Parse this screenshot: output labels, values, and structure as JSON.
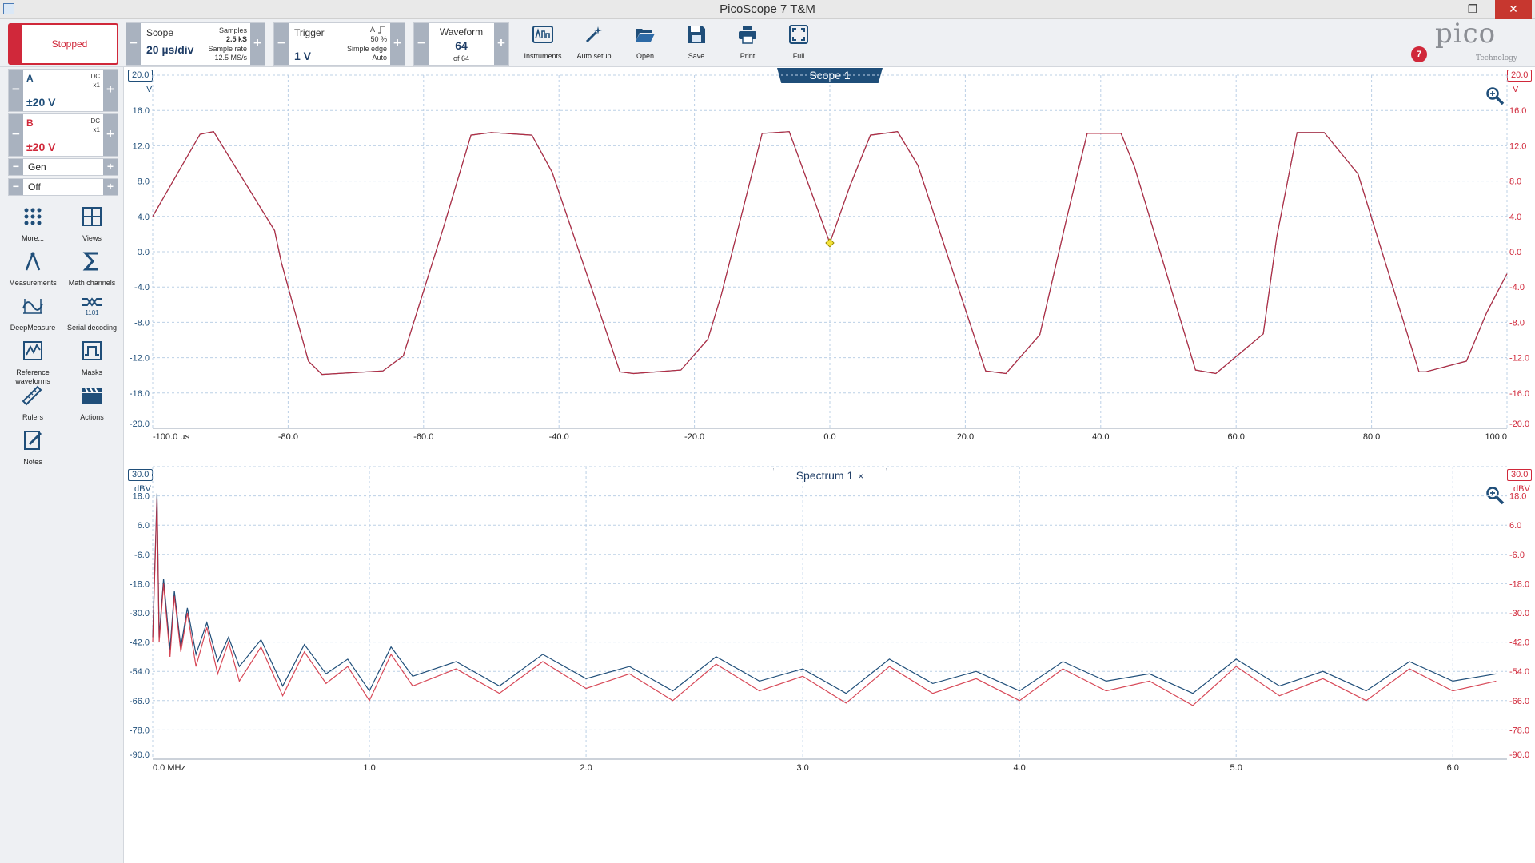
{
  "window": {
    "title": "PicoScope 7 T&M",
    "minimize": "–",
    "maximize": "❐",
    "close": "✕"
  },
  "toolbar": {
    "run_state": "Stopped",
    "scope": {
      "label": "Scope",
      "timebase": "20 µs/div",
      "samples_label": "Samples",
      "samples_value": "2.5 kS",
      "sample_rate_label": "Sample rate",
      "sample_rate_value": "12.5 MS/s"
    },
    "trigger": {
      "label": "Trigger",
      "level": "1 V",
      "channel": "A",
      "position": "50 %",
      "type": "Simple edge",
      "mode": "Auto"
    },
    "waveform": {
      "label": "Waveform",
      "current": "64",
      "of": "of 64"
    },
    "tools": [
      "Instruments",
      "Auto setup",
      "Open",
      "Save",
      "Print",
      "Full"
    ],
    "notifications": "7",
    "logo": "pico",
    "logo_sub": "Technology"
  },
  "sidebar": {
    "channels": [
      {
        "name": "A",
        "coupling": "DC",
        "probe": "x1",
        "range": "±20 V",
        "color": "#1f4e79"
      },
      {
        "name": "B",
        "coupling": "DC",
        "probe": "x1",
        "range": "±20 V",
        "color": "#d0283a"
      }
    ],
    "generator": {
      "label": "Gen",
      "state": "Off"
    },
    "tools": [
      "More...",
      "Views",
      "Measurements",
      "Math channels",
      "DeepMeasure",
      "Serial decoding",
      "Reference waveforms",
      "Masks",
      "Rulers",
      "Actions",
      "Notes"
    ]
  },
  "scope_view": {
    "tab": "Scope 1",
    "left_top": "20.0",
    "right_top": "20.0",
    "unit": "V",
    "y_ticks": [
      "16.0",
      "12.0",
      "8.0",
      "4.0",
      "0.0",
      "-4.0",
      "-8.0",
      "-12.0",
      "-16.0"
    ],
    "bottom": "-20.0",
    "x_ticks": [
      "-100.0 µs",
      "-80.0",
      "-60.0",
      "-40.0",
      "-20.0",
      "0.0",
      "20.0",
      "40.0",
      "60.0",
      "80.0",
      "100.0"
    ]
  },
  "spectrum_view": {
    "tab": "Spectrum 1",
    "close": "×",
    "left_top": "30.0",
    "right_top": "30.0",
    "unit": "dBV",
    "y_ticks": [
      "18.0",
      "6.0",
      "-6.0",
      "-18.0",
      "-30.0",
      "-42.0",
      "-54.0",
      "-66.0",
      "-78.0"
    ],
    "bottom": "-90.0",
    "x_ticks": [
      "0.0 MHz",
      "1.0",
      "2.0",
      "3.0",
      "4.0",
      "5.0",
      "6.0"
    ]
  },
  "chart_data": [
    {
      "type": "line",
      "title": "Scope 1",
      "xlabel": "µs",
      "ylabel": "V",
      "xlim": [
        -100,
        100
      ],
      "ylim": [
        -20,
        20
      ],
      "series": [
        {
          "name": "A",
          "color": "#1f4e79",
          "x": [
            -100,
            -93,
            -91,
            -82,
            -81,
            -77,
            -75,
            -66,
            -63,
            -57,
            -53,
            -50,
            -44,
            -41,
            -31,
            -29,
            -22,
            -18,
            -16,
            -10,
            -6,
            0,
            3,
            6,
            10,
            13,
            23,
            26,
            31,
            35,
            38,
            43,
            45,
            54,
            57,
            64,
            66,
            69,
            73,
            78,
            87,
            88,
            94,
            97,
            100
          ],
          "y": [
            4.0,
            13.3,
            13.6,
            2.4,
            -1.2,
            -12.4,
            -13.9,
            -13.5,
            -11.8,
            2.9,
            13.2,
            13.5,
            13.2,
            9.0,
            -13.6,
            -13.8,
            -13.4,
            -9.9,
            -4.8,
            13.4,
            13.6,
            1.0,
            7.5,
            13.2,
            13.6,
            9.8,
            -13.5,
            -13.8,
            -9.4,
            3.9,
            13.4,
            13.4,
            9.6,
            -13.4,
            -13.8,
            -9.3,
            1.7,
            13.5,
            13.5,
            8.8,
            -13.6,
            -13.6,
            -12.4,
            -6.9,
            -2.5
          ]
        },
        {
          "name": "B",
          "color": "#d0283a",
          "x": [
            -100,
            -93,
            -91,
            -82,
            -81,
            -77,
            -75,
            -66,
            -63,
            -57,
            -53,
            -50,
            -44,
            -41,
            -31,
            -29,
            -22,
            -18,
            -16,
            -10,
            -6,
            0,
            3,
            6,
            10,
            13,
            23,
            26,
            31,
            35,
            38,
            43,
            45,
            54,
            57,
            64,
            66,
            69,
            73,
            78,
            87,
            88,
            94,
            97,
            100
          ],
          "y": [
            4.0,
            13.3,
            13.6,
            2.4,
            -1.2,
            -12.4,
            -13.9,
            -13.5,
            -11.8,
            2.9,
            13.2,
            13.5,
            13.2,
            9.0,
            -13.6,
            -13.8,
            -13.4,
            -9.9,
            -4.8,
            13.4,
            13.6,
            1.0,
            7.5,
            13.2,
            13.6,
            9.8,
            -13.5,
            -13.8,
            -9.4,
            3.9,
            13.4,
            13.4,
            9.6,
            -13.4,
            -13.8,
            -9.3,
            1.7,
            13.5,
            13.5,
            8.8,
            -13.6,
            -13.6,
            -12.4,
            -6.9,
            -2.5
          ]
        }
      ],
      "trigger_marker": {
        "x": 0,
        "y": 1.0
      }
    },
    {
      "type": "line",
      "title": "Spectrum 1",
      "xlabel": "MHz",
      "ylabel": "dBV",
      "xlim": [
        0,
        6.25
      ],
      "ylim": [
        -90,
        30
      ],
      "series": [
        {
          "name": "A",
          "color": "#1f4e79",
          "x": [
            0.0,
            0.02,
            0.03,
            0.05,
            0.08,
            0.1,
            0.13,
            0.16,
            0.2,
            0.25,
            0.3,
            0.35,
            0.4,
            0.5,
            0.6,
            0.7,
            0.8,
            0.9,
            1.0,
            1.1,
            1.2,
            1.4,
            1.6,
            1.8,
            2.0,
            2.2,
            2.4,
            2.6,
            2.8,
            3.0,
            3.2,
            3.4,
            3.6,
            3.8,
            4.0,
            4.2,
            4.4,
            4.6,
            4.8,
            5.0,
            5.2,
            5.4,
            5.6,
            5.8,
            6.0,
            6.2
          ],
          "y": [
            -40,
            19,
            -40,
            -16,
            -45,
            -21,
            -44,
            -28,
            -47,
            -34,
            -50,
            -40,
            -52,
            -41,
            -60,
            -43,
            -55,
            -49,
            -62,
            -44,
            -56,
            -50,
            -60,
            -47,
            -57,
            -52,
            -62,
            -48,
            -58,
            -53,
            -63,
            -49,
            -59,
            -54,
            -62,
            -50,
            -58,
            -55,
            -63,
            -49,
            -60,
            -54,
            -62,
            -50,
            -58,
            -55
          ]
        },
        {
          "name": "B",
          "color": "#d0283a",
          "x": [
            0.0,
            0.02,
            0.03,
            0.05,
            0.08,
            0.1,
            0.13,
            0.16,
            0.2,
            0.25,
            0.3,
            0.35,
            0.4,
            0.5,
            0.6,
            0.7,
            0.8,
            0.9,
            1.0,
            1.1,
            1.2,
            1.4,
            1.6,
            1.8,
            2.0,
            2.2,
            2.4,
            2.6,
            2.8,
            3.0,
            3.2,
            3.4,
            3.6,
            3.8,
            4.0,
            4.2,
            4.4,
            4.6,
            4.8,
            5.0,
            5.2,
            5.4,
            5.6,
            5.8,
            6.0,
            6.2
          ],
          "y": [
            -42,
            17,
            -42,
            -18,
            -48,
            -23,
            -46,
            -30,
            -52,
            -36,
            -55,
            -42,
            -58,
            -44,
            -64,
            -46,
            -59,
            -52,
            -66,
            -47,
            -60,
            -53,
            -63,
            -50,
            -61,
            -55,
            -66,
            -51,
            -62,
            -56,
            -67,
            -52,
            -63,
            -57,
            -66,
            -53,
            -62,
            -58,
            -68,
            -52,
            -64,
            -57,
            -66,
            -53,
            -62,
            -58
          ]
        }
      ]
    }
  ]
}
